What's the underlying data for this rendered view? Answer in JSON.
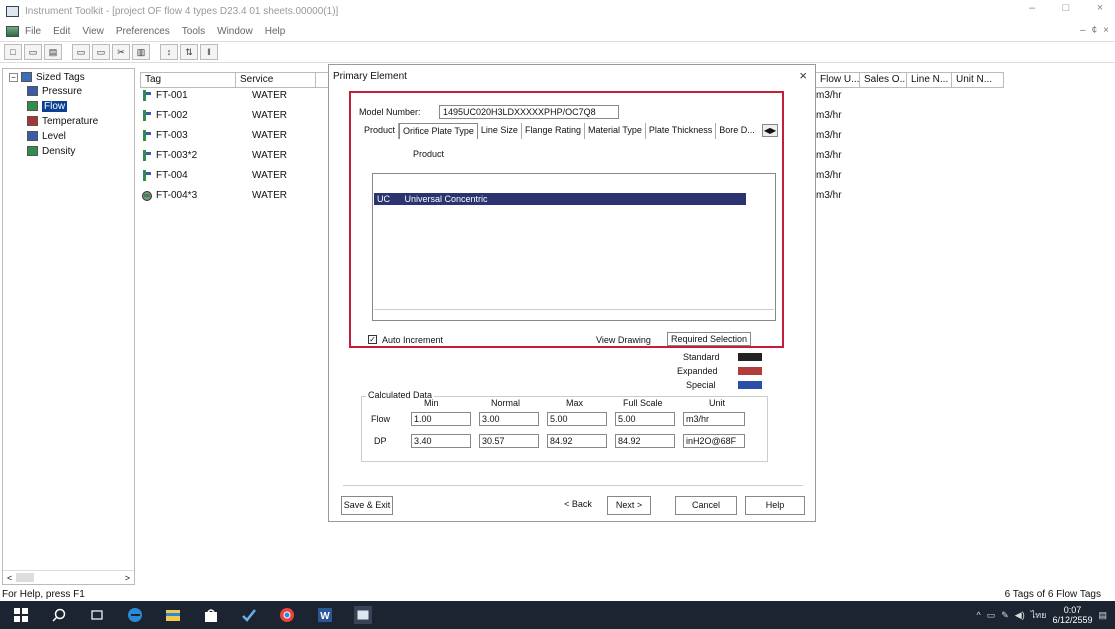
{
  "window": {
    "title": "Instrument Toolkit - [project OF flow 4 types D23.4 01 sheets.00000(1)]",
    "controls": {
      "minimize": "–",
      "maximize": "□",
      "close": "×"
    }
  },
  "menu": [
    "File",
    "Edit",
    "View",
    "Preferences",
    "Tools",
    "Window",
    "Help"
  ],
  "mdi_controls": [
    "–",
    "¢",
    "×"
  ],
  "tree": {
    "root": "Sized Tags",
    "items": [
      {
        "label": "Pressure",
        "icon": "pressure-icon",
        "color": "#3b5aa8"
      },
      {
        "label": "Flow",
        "icon": "flow-icon",
        "color": "#2f8f4a",
        "selected": true
      },
      {
        "label": "Temperature",
        "icon": "temperature-icon",
        "color": "#a33"
      },
      {
        "label": "Level",
        "icon": "level-icon",
        "color": "#3b5aa8"
      },
      {
        "label": "Density",
        "icon": "density-icon",
        "color": "#2f8f4a"
      }
    ],
    "scroll_left": "<",
    "scroll_right": ">"
  },
  "list": {
    "columns": [
      "Tag",
      "Service",
      "Flow U...",
      "Sales O...",
      "Line N...",
      "Unit N..."
    ],
    "rows": [
      {
        "tag": "FT-001",
        "service": "WATER",
        "unit": "m3/hr"
      },
      {
        "tag": "FT-002",
        "service": "WATER",
        "unit": "m3/hr"
      },
      {
        "tag": "FT-003",
        "service": "WATER",
        "unit": "m3/hr"
      },
      {
        "tag": "FT-003*2",
        "service": "WATER",
        "unit": "m3/hr"
      },
      {
        "tag": "FT-004",
        "service": "WATER",
        "unit": "m3/hr"
      },
      {
        "tag": "FT-004*3",
        "service": "WATER",
        "unit": "m3/hr"
      }
    ]
  },
  "dialog": {
    "title": "Primary Element",
    "close": "×",
    "model_label": "Model Number:",
    "model_value": "1495UC020H3LDXXXXXPHP/OC7Q8",
    "tabs": [
      "Product",
      "Orifice Plate Type",
      "Line Size",
      "Flange Rating",
      "Material Type",
      "Plate Thickness",
      "Bore D..."
    ],
    "tab_arrows": "◀▶",
    "list_header": "Product",
    "selected_item": {
      "code": "UC",
      "name": "Universal Concentric"
    },
    "auto_increment_label": "Auto Increment",
    "auto_increment_checked": "✓",
    "view_drawing": "View Drawing",
    "required_selection": "Required Selection",
    "legend": [
      {
        "label": "Standard",
        "color": "#222222"
      },
      {
        "label": "Expanded",
        "color": "#b23b3b"
      },
      {
        "label": "Special",
        "color": "#2a4fa8"
      }
    ],
    "calc": {
      "group_label": "Calculated Data",
      "headers": [
        "Min",
        "Normal",
        "Max",
        "Full Scale",
        "Unit"
      ],
      "rows": [
        {
          "label": "Flow",
          "values": [
            "1.00",
            "3.00",
            "5.00",
            "5.00",
            "m3/hr"
          ]
        },
        {
          "label": "DP",
          "values": [
            "3.40",
            "30.57",
            "84.92",
            "84.92",
            "inH2O@68F"
          ]
        }
      ]
    },
    "buttons": {
      "save_exit": "Save & Exit",
      "back": "< Back",
      "next": "Next >",
      "cancel": "Cancel",
      "help": "Help"
    }
  },
  "status": {
    "left": "For Help, press F1",
    "right": "6 Tags of 6 Flow Tags"
  },
  "taskbar": {
    "clock_time": "0:07",
    "clock_date": "6/12/2559",
    "lang": "ไทย"
  }
}
